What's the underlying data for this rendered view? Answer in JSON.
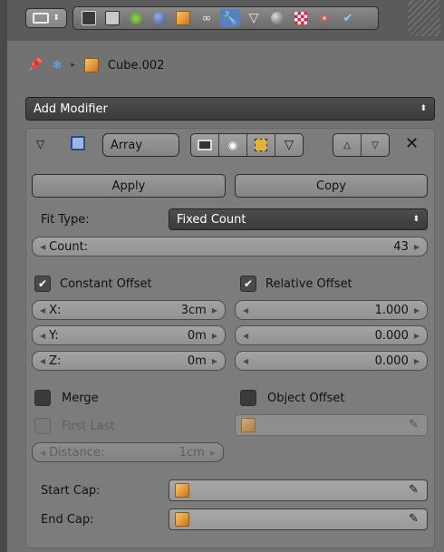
{
  "header": {
    "tabs": [
      {
        "icon": "render-camera-icon"
      },
      {
        "icon": "render-layers-icon"
      },
      {
        "icon": "scene-icon"
      },
      {
        "icon": "world-icon"
      },
      {
        "icon": "object-icon"
      },
      {
        "icon": "constraints-icon"
      },
      {
        "icon": "modifiers-wrench-icon",
        "active": true
      },
      {
        "icon": "data-mesh-icon"
      },
      {
        "icon": "material-icon"
      },
      {
        "icon": "texture-icon"
      },
      {
        "icon": "particles-icon"
      },
      {
        "icon": "physics-icon"
      }
    ]
  },
  "context": {
    "object_name": "Cube.002"
  },
  "add_modifier": {
    "label": "Add Modifier"
  },
  "modifier": {
    "name": "Array",
    "apply_label": "Apply",
    "copy_label": "Copy",
    "fit_type": {
      "label": "Fit Type:",
      "value": "Fixed Count"
    },
    "count": {
      "label": "Count:",
      "value": "43"
    },
    "constant_offset": {
      "label": "Constant Offset",
      "checked": true,
      "x": {
        "label": "X:",
        "value": "3cm"
      },
      "y": {
        "label": "Y:",
        "value": "0m"
      },
      "z": {
        "label": "Z:",
        "value": "0m"
      }
    },
    "relative_offset": {
      "label": "Relative Offset",
      "checked": true,
      "x": "1.000",
      "y": "0.000",
      "z": "0.000"
    },
    "merge": {
      "label": "Merge",
      "checked": false
    },
    "first_last": {
      "label": "First Last",
      "checked": false
    },
    "distance": {
      "label": "Distance:",
      "value": "1cm"
    },
    "object_offset": {
      "label": "Object Offset",
      "checked": false
    },
    "start_cap": {
      "label": "Start Cap:"
    },
    "end_cap": {
      "label": "End Cap:"
    }
  },
  "colors": {
    "active_tab": "#5680c2",
    "panel_bg": "#7c7c7c",
    "dark_dropdown": "#434343"
  }
}
